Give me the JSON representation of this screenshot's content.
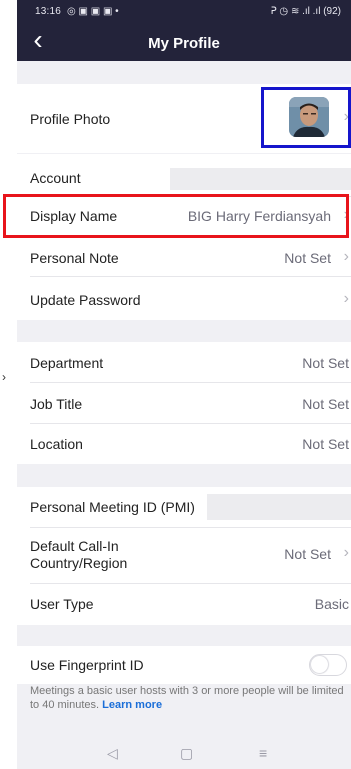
{
  "status_bar": {
    "time": "13:16",
    "notifications": "◎ ▣ ▣ ▣ •",
    "right_icons": "ᕈ ◷ ≋ .ıl .ıl (92)"
  },
  "header": {
    "back_icon": "‹",
    "title": "My Profile"
  },
  "rows": {
    "profile_photo": {
      "label": "Profile Photo",
      "chevron": "›"
    },
    "account": {
      "label": "Account"
    },
    "display_name": {
      "label": "Display Name",
      "value": "BIG Harry Ferdiansyah",
      "chevron": "›"
    },
    "personal_note": {
      "label": "Personal Note",
      "value": "Not Set",
      "chevron": "›"
    },
    "update_password": {
      "label": "Update Password",
      "chevron": "›"
    },
    "department": {
      "label": "Department",
      "value": "Not Set"
    },
    "job_title": {
      "label": "Job Title",
      "value": "Not Set"
    },
    "location": {
      "label": "Location",
      "value": "Not Set"
    },
    "pmi": {
      "label": "Personal Meeting ID (PMI)"
    },
    "call_in": {
      "label_line1": "Default Call-In",
      "label_line2": "Country/Region",
      "value": "Not Set",
      "chevron": "›"
    },
    "user_type": {
      "label": "User Type",
      "value": "Basic"
    },
    "fingerprint": {
      "label": "Use Fingerprint ID",
      "enabled": false
    }
  },
  "footer": {
    "note": "Meetings a basic user hosts with 3 or more people will be limited to 40 minutes.",
    "link": "Learn more"
  },
  "system_nav": {
    "back": "◁",
    "home": "▢",
    "menu": "≡"
  },
  "side_mark": "›",
  "colors": {
    "header_bg": "#23233a",
    "annotation_red": "#e8141b",
    "annotation_blue": "#1515cc",
    "link": "#1a6ed8"
  }
}
